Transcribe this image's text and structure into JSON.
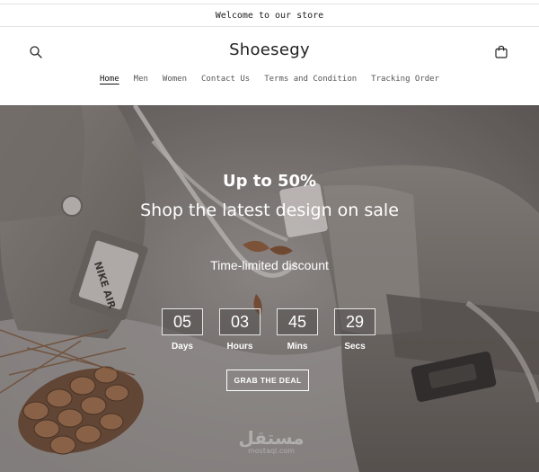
{
  "announcement": "Welcome to our store",
  "header": {
    "logo": "Shoesegy",
    "search_icon": "search-icon",
    "cart_icon": "shopping-bag-icon"
  },
  "nav": {
    "items": [
      {
        "label": "Home",
        "active": true
      },
      {
        "label": "Men",
        "active": false
      },
      {
        "label": "Women",
        "active": false
      },
      {
        "label": "Contact Us",
        "active": false
      },
      {
        "label": "Terms and Condition",
        "active": false
      },
      {
        "label": "Tracking Order",
        "active": false
      }
    ]
  },
  "hero": {
    "kicker": "Up to 50%",
    "headline": "Shop the latest design on sale",
    "subline": "Time-limited discount",
    "countdown": [
      {
        "value": "05",
        "label": "Days"
      },
      {
        "value": "03",
        "label": "Hours"
      },
      {
        "value": "45",
        "label": "Mins"
      },
      {
        "value": "29",
        "label": "Secs"
      }
    ],
    "cta_label": "GRAB THE DEAL",
    "shoe_tag_text": "NIKE AIR",
    "watermark": {
      "arabic": "مستقل",
      "latin": "mostaql.com"
    }
  },
  "colors": {
    "hero_overlay": "#6f6a67",
    "text_white": "#ffffff",
    "accent_text": "#121212"
  }
}
